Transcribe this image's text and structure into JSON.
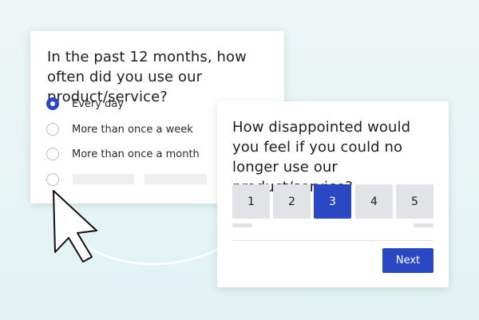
{
  "question_one": {
    "title": "In the past 12 months, how often did you use our product/service?",
    "options": [
      {
        "label": "Every day",
        "selected": true
      },
      {
        "label": "More than once a week",
        "selected": false
      },
      {
        "label": "More than once a month",
        "selected": false
      },
      {
        "label": "",
        "selected": false
      }
    ]
  },
  "question_two": {
    "title": "How disappointed would you feel if you could no longer use our product/service?",
    "scale": [
      "1",
      "2",
      "3",
      "4",
      "5"
    ],
    "selected_value": "3",
    "next_label": "Next"
  },
  "colors": {
    "accent": "#2a48c4",
    "background": "#e6f4f4",
    "scale_default": "#e1e3e6"
  },
  "icons": [
    "radio-checked-icon",
    "radio-unchecked-icon",
    "arrow-cursor-icon"
  ]
}
